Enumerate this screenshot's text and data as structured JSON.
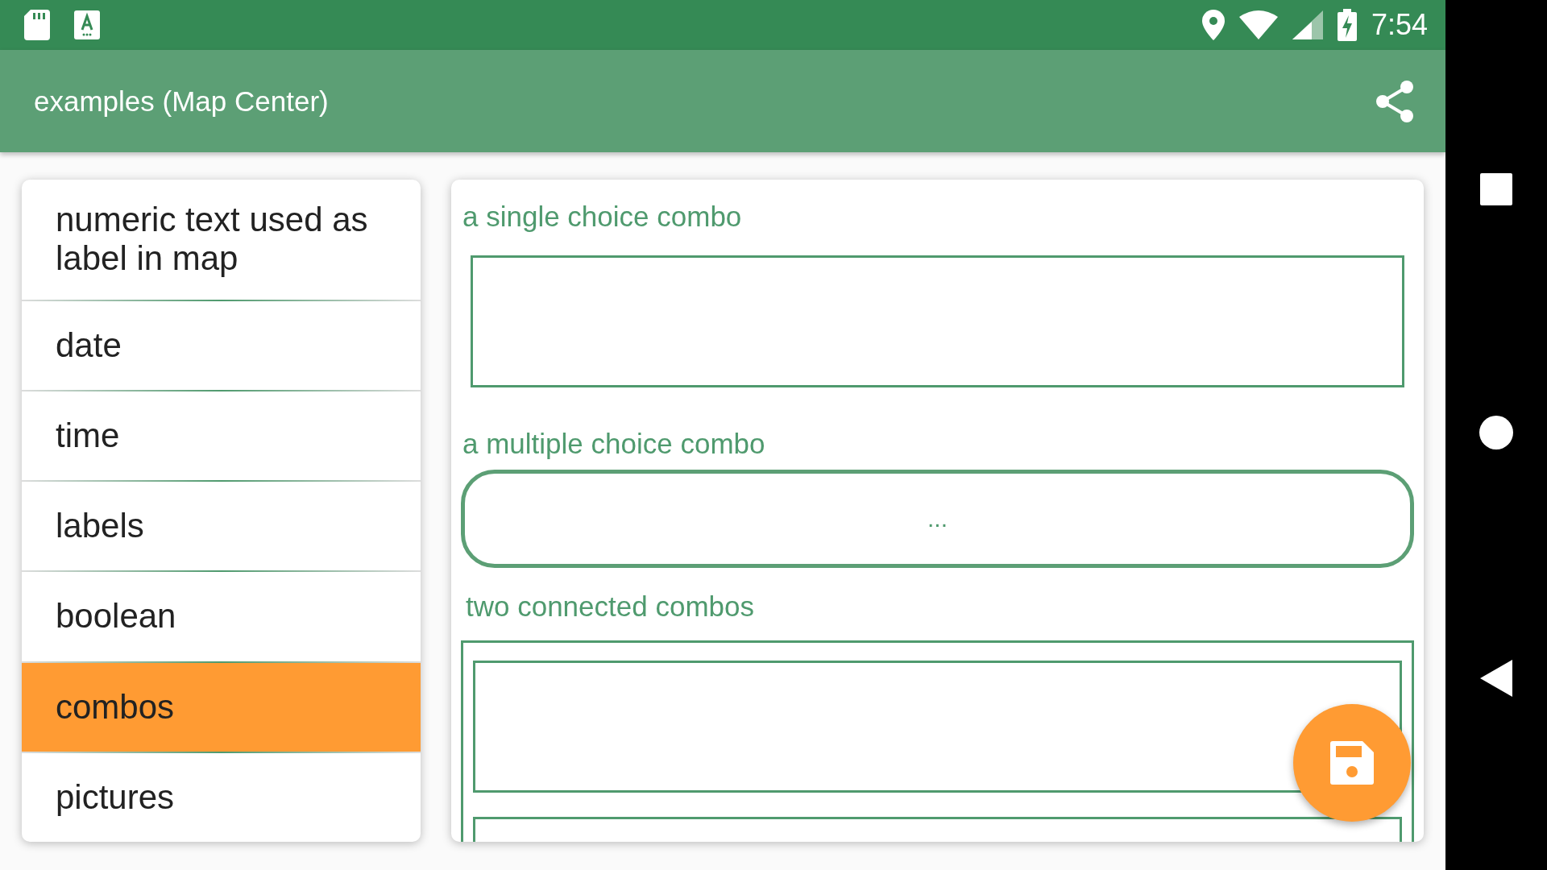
{
  "status_bar": {
    "time": "7:54"
  },
  "app_bar": {
    "title": "examples (Map Center)"
  },
  "sidebar": {
    "items": [
      {
        "label": "numeric text used as label in map",
        "selected": false
      },
      {
        "label": "date",
        "selected": false
      },
      {
        "label": "time",
        "selected": false
      },
      {
        "label": "labels",
        "selected": false
      },
      {
        "label": "boolean",
        "selected": false
      },
      {
        "label": "combos",
        "selected": true
      },
      {
        "label": "pictures",
        "selected": false
      }
    ]
  },
  "form": {
    "fields": [
      {
        "kind": "single",
        "label": "a single choice combo"
      },
      {
        "kind": "multi",
        "label": "a multiple choice combo",
        "value": "..."
      },
      {
        "kind": "connected",
        "label": "two connected combos"
      }
    ]
  }
}
